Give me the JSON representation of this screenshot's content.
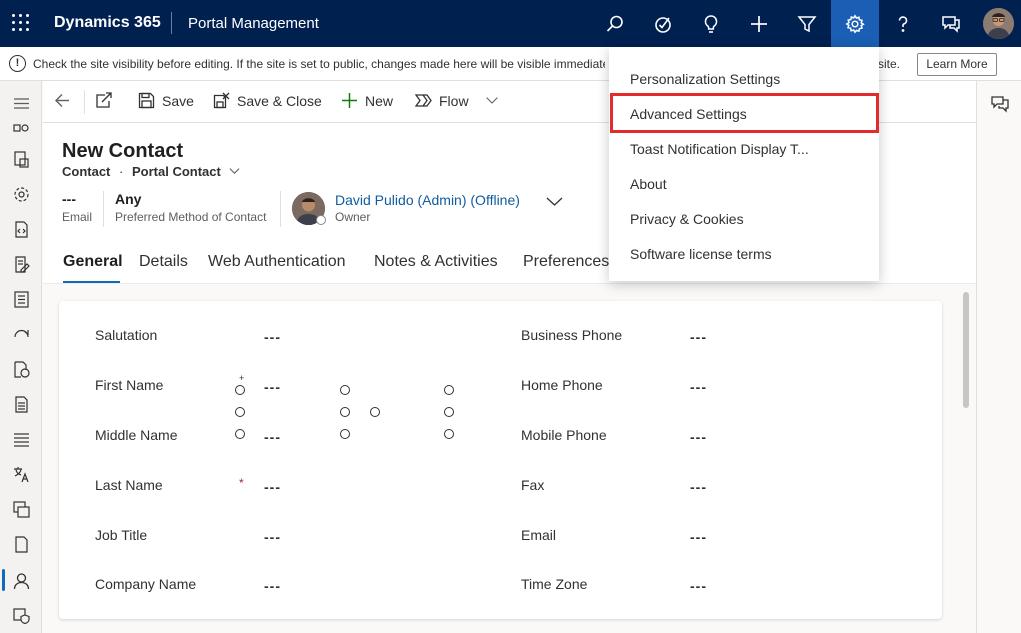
{
  "topbar": {
    "brand": "Dynamics 365",
    "app_name": "Portal Management",
    "icons": [
      "search-icon",
      "task-icon",
      "lightbulb-icon",
      "plus-icon",
      "filter-icon",
      "gear-icon",
      "help-icon",
      "chat-icon"
    ],
    "active_color": "#1a5fb4",
    "bar_color": "#002050"
  },
  "notice": {
    "message": "Check the site visibility before editing. If the site is set to public, changes made here will be visible immediately",
    "message_tail": "site.",
    "learn_more": "Learn More"
  },
  "commands": {
    "save": "Save",
    "save_close": "Save & Close",
    "new": "New",
    "flow": "Flow"
  },
  "record": {
    "title": "New Contact",
    "entity": "Contact",
    "form": "Portal Contact",
    "email_value": "---",
    "email_label": "Email",
    "pref_value": "Any",
    "pref_label": "Preferred Method of Contact",
    "owner_name": "David Pulido (Admin) (Offline)",
    "owner_label": "Owner"
  },
  "tabs": [
    "General",
    "Details",
    "Web Authentication",
    "Notes & Activities",
    "Preferences"
  ],
  "form": {
    "left": [
      {
        "label": "Salutation",
        "value": "---"
      },
      {
        "label": "First Name",
        "value": "---"
      },
      {
        "label": "Middle Name",
        "value": "---"
      },
      {
        "label": "Last Name",
        "value": "---"
      },
      {
        "label": "Job Title",
        "value": "---"
      },
      {
        "label": "Company Name",
        "value": "---"
      }
    ],
    "right": [
      {
        "label": "Business Phone",
        "value": "---"
      },
      {
        "label": "Home Phone",
        "value": "---"
      },
      {
        "label": "Mobile Phone",
        "value": "---"
      },
      {
        "label": "Fax",
        "value": "---"
      },
      {
        "label": "Email",
        "value": "---"
      },
      {
        "label": "Time Zone",
        "value": "---"
      }
    ],
    "required_mark": "*",
    "recommended_mark": "+"
  },
  "settings_menu": {
    "items": [
      "Personalization Settings",
      "Advanced Settings",
      "Toast Notification Display T...",
      "About",
      "Privacy & Cookies",
      "Software license terms"
    ],
    "highlight_color": "#e32b2b"
  }
}
